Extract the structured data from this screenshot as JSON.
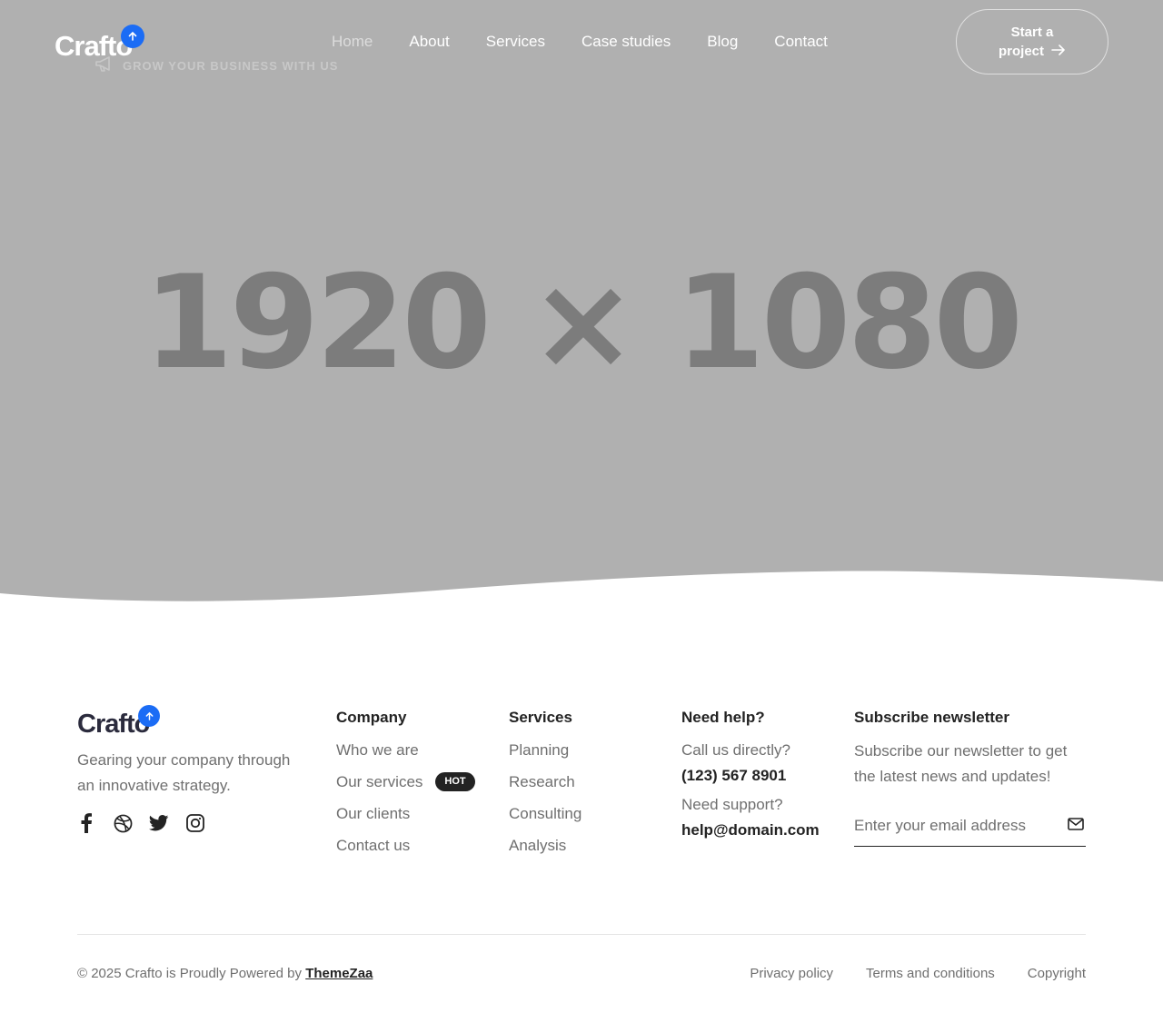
{
  "header": {
    "logo_text": "Crafto",
    "tagline": "GROW YOUR BUSINESS WITH US",
    "nav": [
      {
        "label": "Home",
        "active": true
      },
      {
        "label": "About"
      },
      {
        "label": "Services"
      },
      {
        "label": "Case studies"
      },
      {
        "label": "Blog"
      },
      {
        "label": "Contact"
      }
    ],
    "cta_line1": "Start a",
    "cta_line2": "project"
  },
  "hero": {
    "placeholder_text": "1920 × 1080",
    "background_color": "#b0b0b0"
  },
  "footer": {
    "logo_text": "Crafto",
    "about_text": "Gearing your company through an innovative strategy.",
    "social": [
      "facebook-icon",
      "dribbble-icon",
      "twitter-icon",
      "instagram-icon"
    ],
    "company": {
      "title": "Company",
      "items": [
        "Who we are",
        "Our services",
        "Our clients",
        "Contact us"
      ],
      "badge": "HOT"
    },
    "services": {
      "title": "Services",
      "items": [
        "Planning",
        "Research",
        "Consulting",
        "Analysis"
      ]
    },
    "help": {
      "title": "Need help?",
      "call_label": "Call us directly?",
      "phone": "(123) 567 8901",
      "support_label": "Need support?",
      "email": "help@domain.com"
    },
    "newsletter": {
      "title": "Subscribe newsletter",
      "text": "Subscribe our newsletter to get the latest news and updates!",
      "placeholder": "Enter your email address"
    },
    "copyright_prefix": "© 2025 Crafto is Proudly Powered by",
    "copyright_link": "ThemeZaa",
    "legal": [
      "Privacy policy",
      "Terms and conditions",
      "Copyright"
    ]
  },
  "colors": {
    "accent": "#1b6cf5",
    "dark": "#232323",
    "muted": "#6f6f6f"
  }
}
